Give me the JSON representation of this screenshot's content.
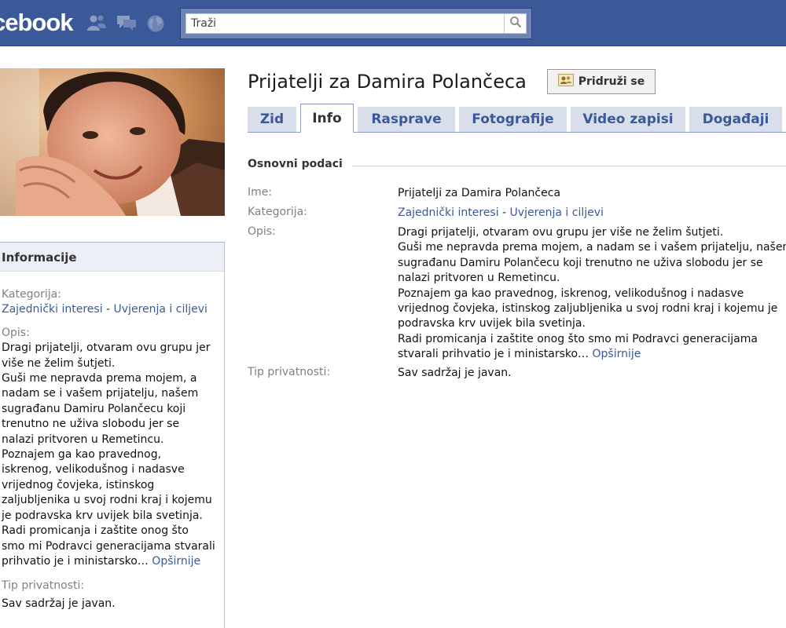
{
  "header": {
    "logo": "cebook",
    "search": {
      "placeholder": "Traži",
      "value": ""
    },
    "jewels": [
      "friends-icon",
      "messages-icon",
      "notifications-globe-icon"
    ]
  },
  "group": {
    "title": "Prijatelji za Damira Polančeca",
    "join_label": "Pridruži se"
  },
  "tabs": [
    {
      "label": "Zid",
      "active": false
    },
    {
      "label": "Info",
      "active": true
    },
    {
      "label": "Rasprave",
      "active": false
    },
    {
      "label": "Fotografije",
      "active": false
    },
    {
      "label": "Video zapisi",
      "active": false
    },
    {
      "label": "Događaji",
      "active": false
    }
  ],
  "sidebar": {
    "header": "Informacije",
    "category_label": "Kategorija:",
    "category_link_1": "Zajednički interesi",
    "category_sep": " - ",
    "category_link_2": "Uvjerenja i ciljevi",
    "description_label": "Opis:",
    "description_lines": [
      "Dragi prijatelji, otvaram ovu grupu jer",
      "više ne želim šutjeti.",
      "Guši me nepravda prema mojem, a",
      "nadam se i vašem prijatelju, našem",
      "sugrađanu Damiru Polančecu koji",
      "trenutno ne uživa slobodu jer se",
      "nalazi pritvoren u Remetincu.",
      "Poznajem ga kao pravednog,",
      "iskrenog, velikodušnog i nadasve",
      "vrijednog čovjeka, istinskog",
      "zaljubljenika u svoj rodni kraj i kojemu",
      "je podravska krv uvijek bila svetinja.",
      "Radi promicanja i zaštite onog što",
      "smo mi Podravci generacijama stvarali"
    ],
    "description_last_line": "prihvatio je i ministarsko…",
    "more_link": "Opširnije",
    "privacy_label": "Tip privatnosti:",
    "privacy_value": "Sav sadržaj je javan."
  },
  "basic_info": {
    "section_title": "Osnovni podaci",
    "name_label": "Ime:",
    "name_value": "Prijatelji za Damira Polančeca",
    "category_label": "Kategorija:",
    "category_link_1": "Zajednički interesi",
    "category_sep": " - ",
    "category_link_2": "Uvjerenja i ciljevi",
    "description_label": "Opis:",
    "description_lines": [
      "Dragi prijatelji, otvaram ovu grupu jer više ne želim šutjeti.",
      "Guši me nepravda prema mojem, a nadam se i vašem prijatelju, našem",
      "sugrađanu Damiru Polančecu koji trenutno ne uživa slobodu jer se",
      "nalazi pritvoren u Remetincu.",
      "Poznajem ga kao pravednog, iskrenog, velikodušnog i nadasve",
      "vrijednog čovjeka, istinskog zaljubljenika u svoj rodni kraj i kojemu je",
      "podravska krv uvijek bila svetinja.",
      "Radi promicanja i zaštite onog što smo mi Podravci generacijama"
    ],
    "description_last_line": "stvarali prihvatio je i ministarsko…",
    "more_link": "Opširnije",
    "privacy_label": "Tip privatnosti:",
    "privacy_value": "Sav sadržaj je javan."
  },
  "colors": {
    "brand_blue": "#3b5998",
    "tab_bg": "#d8dfea",
    "label_gray": "#808080"
  }
}
